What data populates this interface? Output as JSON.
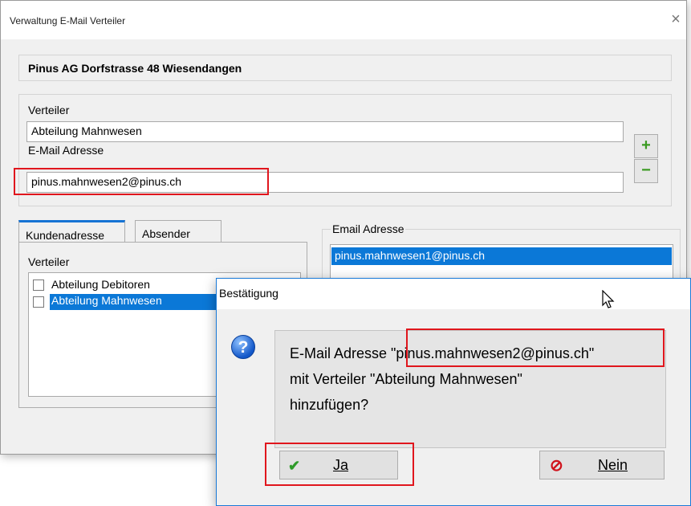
{
  "window": {
    "title": "Verwaltung E-Mail Verteiler",
    "close_glyph": "×"
  },
  "header": {
    "address": "Pinus AG Dorfstrasse 48 Wiesendangen"
  },
  "form": {
    "distributor_label": "Verteiler",
    "distributor_value": "Abteilung Mahnwesen",
    "email_label": "E-Mail Adresse",
    "email_value": "pinus.mahnwesen2@pinus.ch",
    "add_glyph": "+",
    "remove_glyph": "−"
  },
  "tabs": [
    {
      "label": "Kundenadresse",
      "active": true
    },
    {
      "label": "Absender",
      "active": false
    }
  ],
  "distributor_list": {
    "label": "Verteiler",
    "items": [
      {
        "label": "Abteilung Debitoren",
        "checked": false,
        "selected": false
      },
      {
        "label": "Abteilung Mahnwesen",
        "checked": false,
        "selected": true
      }
    ]
  },
  "email_group": {
    "label": "Email Adresse",
    "items": [
      "pinus.mahnwesen1@pinus.ch"
    ]
  },
  "dialog": {
    "title": "Bestätigung",
    "message_line1_prefix": "E-Mail Adresse ",
    "message_line1_email": "\"pinus.mahnwesen2@pinus.ch\"",
    "message_line2": "mit Verteiler \"Abteilung Mahnwesen\"",
    "message_line3": "hinzufügen?",
    "yes_label": "Ja",
    "yes_icon": "✔",
    "no_label": "Nein",
    "no_icon": "⊘",
    "question_glyph": "?"
  },
  "colors": {
    "accent": "#0b78d7",
    "highlight_red": "#e0161d",
    "add_green": "#3a9a21",
    "no_red": "#d0121b"
  }
}
